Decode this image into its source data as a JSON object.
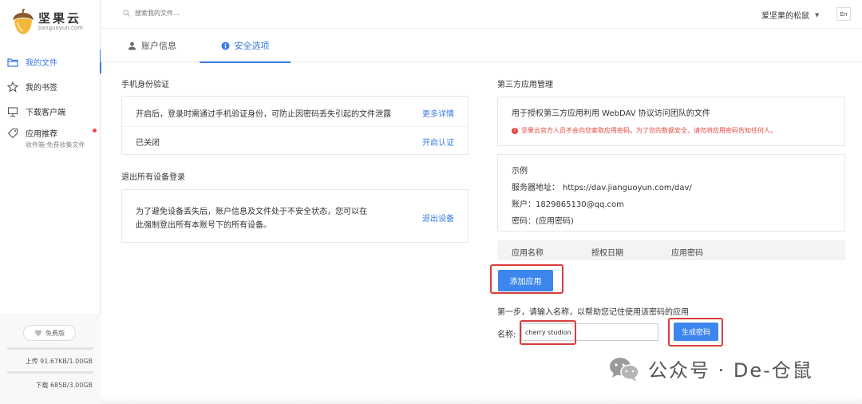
{
  "sidebar": {
    "logo_text": "坚果云",
    "logo_sub": "jianguoyun.com",
    "items": [
      {
        "label": "我的文件",
        "icon": "folder-icon"
      },
      {
        "label": "我的书签",
        "icon": "star-icon"
      },
      {
        "label": "下载客户端",
        "icon": "monitor-icon"
      },
      {
        "label": "应用推荐",
        "sub": "收件箱·免费收集文件",
        "icon": "tag-icon"
      }
    ],
    "plan_label": "免费版",
    "upload_quota": "上传 91.67KB/1.00GB",
    "download_quota": "下载 685B/3.00GB",
    "upload_progress_percent": 0.01,
    "download_progress_percent": 0.0
  },
  "topbar": {
    "search_placeholder": "搜索我的文件...",
    "user_name": "爱坚果的松鼠",
    "lang": "En"
  },
  "tabs": [
    {
      "label": "账户信息",
      "active": false
    },
    {
      "label": "安全选项",
      "active": true
    }
  ],
  "phone_auth": {
    "title": "手机身份验证",
    "description": "开启后，登录时需通过手机验证身份，可防止因密码丢失引起的文件泄露",
    "more_link": "更多详情",
    "status": "已关闭",
    "enable_link": "开启认证"
  },
  "logout_all": {
    "title": "退出所有设备登录",
    "description_line1": "为了避免设备丢失后，账户信息及文件处于不安全状态，您可以在",
    "description_line2": "此强制登出所有本账号下的所有设备。",
    "logout_link": "退出设备"
  },
  "third_party": {
    "title": "第三方应用管理",
    "description": "用于授权第三方应用利用 WebDAV 协议访问团队的文件",
    "warning": "坚果云官方人员不会向您索取应用密码。为了您的数据安全，请勿将应用密码告知任何人。",
    "example_title": "示例",
    "server_label": "服务器地址：",
    "server_value": "https://dav.jianguoyun.com/dav/",
    "account_label": "账户：",
    "account_value": "1829865130@qq.com",
    "password_label": "密码：",
    "password_value": "(应用密码)",
    "table_headers": [
      "应用名称",
      "授权日期",
      "应用密码"
    ],
    "add_button": "添加应用",
    "step_text": "第一步，请输入名称，以帮助您记住使用该密码的应用",
    "name_label": "名称:",
    "name_value": "cherry studion",
    "generate_button": "生成密码"
  },
  "watermark": {
    "text": "公众号 · De-仓鼠"
  },
  "colors": {
    "accent": "#3a7be4",
    "button": "#3d86ee",
    "warning": "#e04a3f",
    "highlight_box": "#d93c3c"
  }
}
